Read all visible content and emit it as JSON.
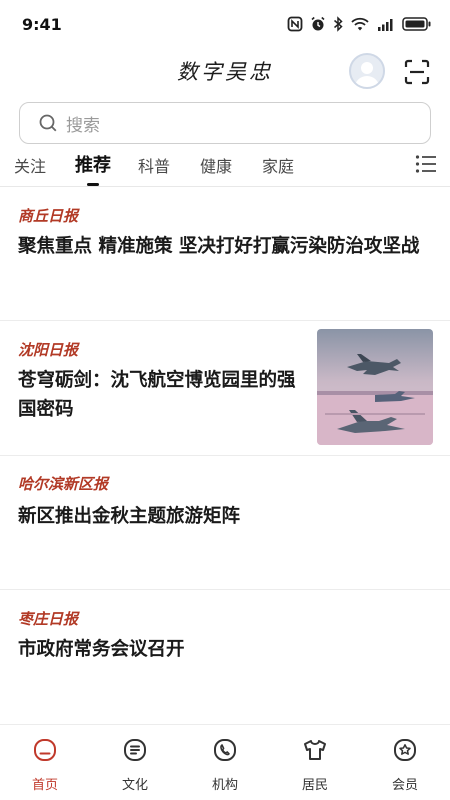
{
  "status_bar": {
    "time": "9:41"
  },
  "header": {
    "title": "数字吴忠",
    "avatar_icon": "user-avatar-icon",
    "scan_icon": "scan-icon"
  },
  "search": {
    "placeholder": "搜索"
  },
  "tabs": {
    "items": [
      {
        "label": "关注"
      },
      {
        "label": "推荐",
        "active": true
      },
      {
        "label": "科普"
      },
      {
        "label": "健康"
      },
      {
        "label": "家庭"
      }
    ],
    "menu_icon": "list-menu-icon"
  },
  "news": [
    {
      "source": "商丘日报",
      "title": "聚焦重点 精准施策 坚决打好打赢污染防治攻坚战"
    },
    {
      "source": "沈阳日报",
      "title": "苍穹砺剑：沈飞航空博览园里的强国密码",
      "has_image": true
    },
    {
      "source": "哈尔滨新区报",
      "title": "新区推出金秋主题旅游矩阵"
    },
    {
      "source": "枣庄日报",
      "title": "市政府常务会议召开"
    }
  ],
  "bottom_nav": [
    {
      "label": "首页",
      "icon": "home-icon",
      "active": true
    },
    {
      "label": "文化",
      "icon": "culture-icon"
    },
    {
      "label": "机构",
      "icon": "phone-icon"
    },
    {
      "label": "居民",
      "icon": "shirt-icon"
    },
    {
      "label": "会员",
      "icon": "star-badge-icon"
    }
  ],
  "colors": {
    "accent": "#c0392b",
    "source": "#b23a26"
  }
}
